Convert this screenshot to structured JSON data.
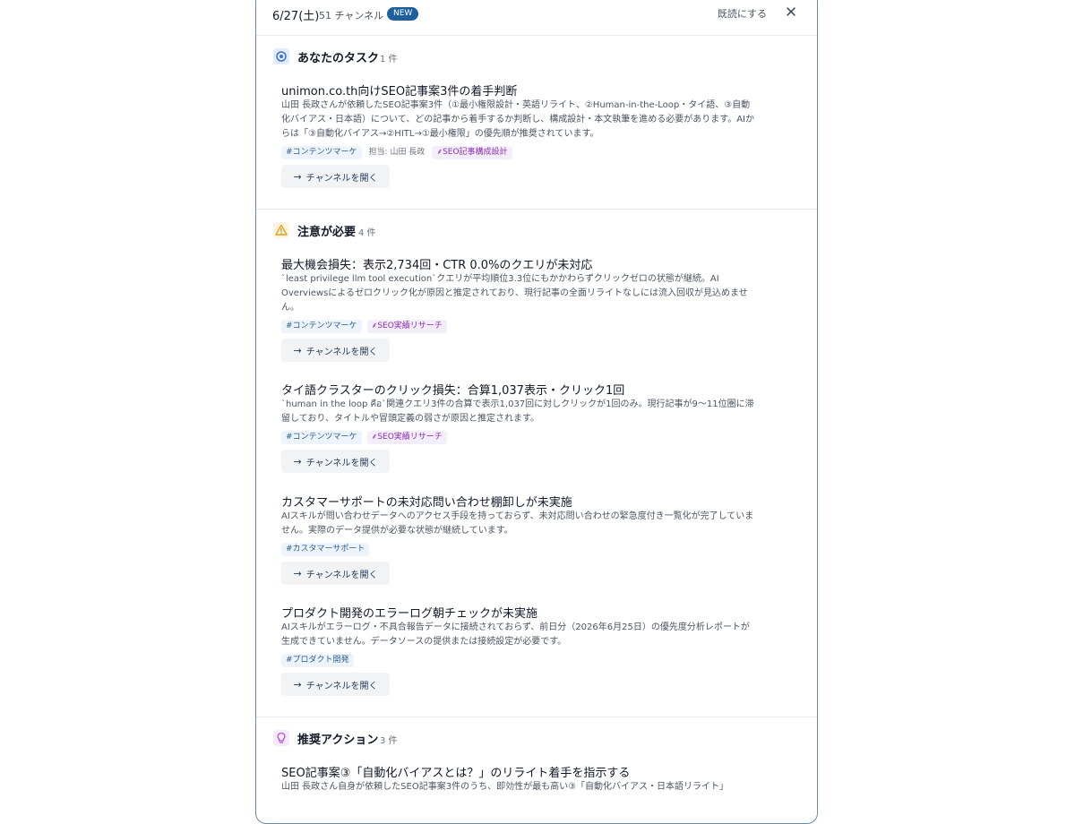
{
  "header": {
    "date": "6/27(土)",
    "channel_count": "51 チャンネル",
    "badge": "NEW",
    "mark_read": "既読にする",
    "close_icon": "close-icon"
  },
  "sections": [
    {
      "title": "あなたのタスク",
      "count": "1 件",
      "icon": "target-icon",
      "color": "#3b6fd6",
      "items": [
        {
          "title": "unimon.co.th向けSEO記事案3件の着手判断",
          "desc": "山田 長政さんが依頼したSEO記事案3件（①最小権限設計・英語リライト、②Human-in-the-Loop・タイ語、③自動化バイアス・日本語）について、どの記事から着手するか判断し、構成設計・本文執筆を進める必要があります。AIからは「③自動化バイアス→②HITL→①最小権限」の優先順が推奨されています。",
          "tags": [
            "#コンテンツマーケ",
            "担当: 山田 長政",
            "SEO記事構成設計"
          ],
          "button": "チャンネルを開く"
        }
      ]
    },
    {
      "title": "注意が必要",
      "count": "4 件",
      "icon": "warning-icon",
      "color": "#e0a020",
      "items": [
        {
          "title": "最大機会損失：表示2,734回・CTR 0.0%のクエリが未対応",
          "desc": "`least privilege llm tool execution`クエリが平均順位3.3位にもかかわらずクリックゼロの状態が継続。AI Overviewsによるゼロクリック化が原因と推定されており、現行記事の全面リライトなしには流入回収が見込めません。",
          "tags": [
            "#コンテンツマーケ",
            "SEO実績リサーチ"
          ],
          "button": "チャンネルを開く"
        },
        {
          "title": "タイ語クラスターのクリック損失：合算1,037表示・クリック1回",
          "desc": "`human in the loop คือ`関連クエリ3件の合算で表示1,037回に対しクリックが1回のみ。現行記事が9〜11位圏に滞留しており、タイトルや冒頭定義の弱さが原因と推定されます。",
          "tags": [
            "#コンテンツマーケ",
            "SEO実績リサーチ"
          ],
          "button": "チャンネルを開く"
        },
        {
          "title": "カスタマーサポートの未対応問い合わせ棚卸しが未実施",
          "desc": "AIスキルが問い合わせデータへのアクセス手段を持っておらず、未対応問い合わせの緊急度付き一覧化が完了していません。実際のデータ提供が必要な状態が継続しています。",
          "tags": [
            "#カスタマーサポート"
          ],
          "button": "チャンネルを開く"
        },
        {
          "title": "プロダクト開発のエラーログ朝チェックが未実施",
          "desc": "AIスキルがエラーログ・不具合報告データに接続されておらず、前日分（2026年6月25日）の優先度分析レポートが生成できていません。データソースの提供または接続設定が必要です。",
          "tags": [
            "#プロダクト開発"
          ],
          "button": "チャンネルを開く"
        }
      ]
    },
    {
      "title": "推奨アクション",
      "count": "3 件",
      "icon": "lightbulb-icon",
      "color": "#b04fd6",
      "items": [
        {
          "title": "SEO記事案③「自動化バイアスとは？」のリライト着手を指示する",
          "desc": "山田 長政さん自身が依頼したSEO記事案3件のうち、即効性が最も高い③「自動化バイアス・日本語リライト」",
          "tags": [],
          "button": ""
        }
      ]
    }
  ]
}
